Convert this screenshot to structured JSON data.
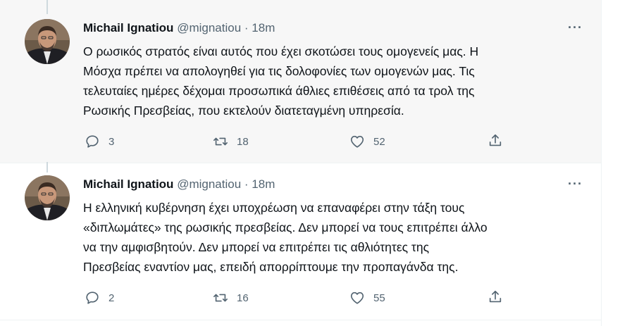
{
  "tweets": [
    {
      "author_name": "Michail Ignatiou",
      "handle": "@mignatiou",
      "separator": "·",
      "time": "18m",
      "more_label": "···",
      "text_lines": [
        "Ο ρωσικός στρατός είναι αυτός που έχει σκοτώσει τους ομογενείς μας. Η",
        "Μόσχα πρέπει να απολογηθεί για τις δολοφονίες των ομογενών μας. Τις",
        "τελευταίες ημέρες δέχομαι προσωπικά άθλιες επιθέσεις από τα τρολ της",
        "Ρωσικής Πρεσβείας, που εκτελούν διατεταγμένη υπηρεσία."
      ],
      "replies": "3",
      "retweets": "18",
      "likes": "52"
    },
    {
      "author_name": "Michail Ignatiou",
      "handle": "@mignatiou",
      "separator": "·",
      "time": "18m",
      "more_label": "···",
      "text_lines": [
        "Η ελληνική κυβέρνηση έχει υποχρέωση να επαναφέρει στην τάξη τους",
        "«διπλωμάτες» της ρωσικής πρεσβείας. Δεν μπορεί να τους επιτρέπει άλλο",
        "να την αμφισβητούν. Δεν μπορεί να επιτρέπει τις αθλιότητες της",
        "Πρεσβείας εναντίον μας, επειδή απορρίπτουμε την προπαγάνδα της."
      ],
      "replies": "2",
      "retweets": "16",
      "likes": "55"
    }
  ],
  "icons": {
    "reply": "reply-icon",
    "retweet": "retweet-icon",
    "like": "like-icon",
    "share": "share-icon",
    "more": "more-icon"
  },
  "colors": {
    "text": "#0f1419",
    "secondary": "#536471",
    "highlight_bg": "#f7f7f7",
    "thread_line": "#cfd9de"
  }
}
